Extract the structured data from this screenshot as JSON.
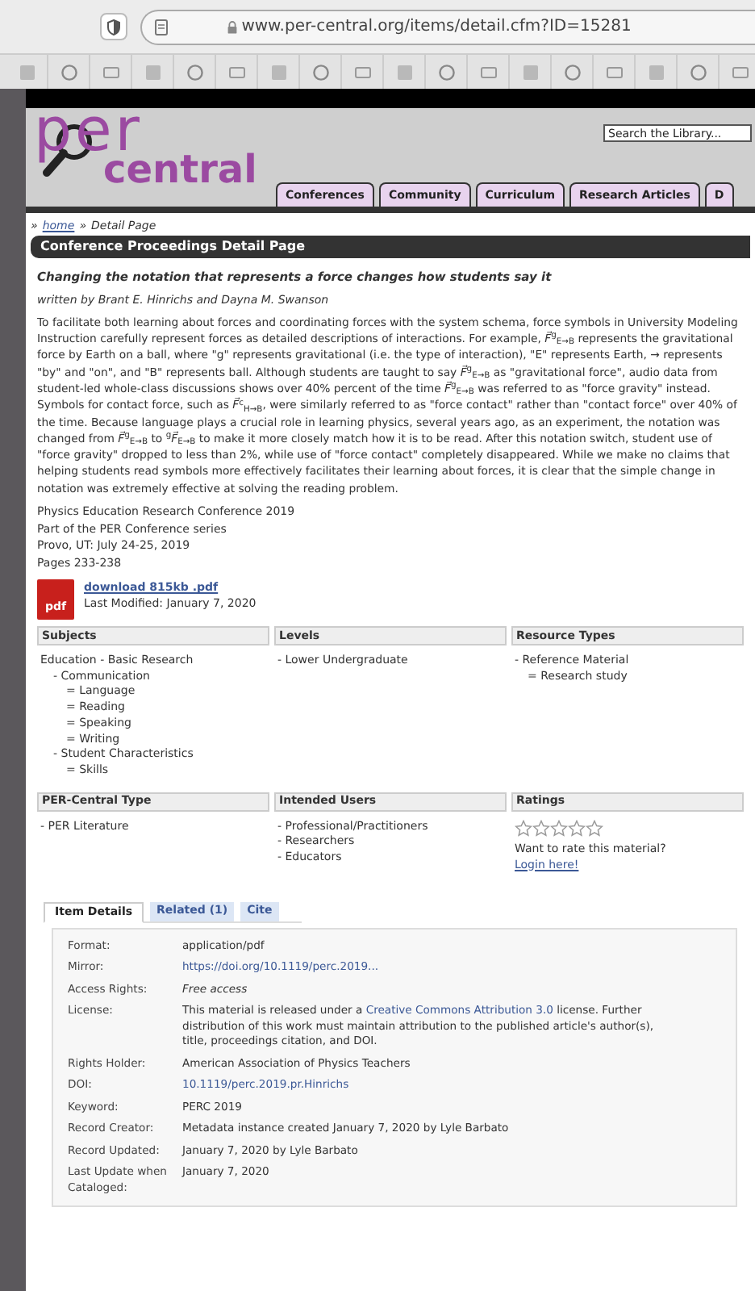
{
  "browser": {
    "url": "www.per-central.org/items/detail.cfm?ID=15281"
  },
  "header": {
    "logo_top": "per",
    "logo_bottom": "central",
    "search": {
      "placeholder": "Search the Library..."
    },
    "nav": [
      {
        "label": "Conferences"
      },
      {
        "label": "Community"
      },
      {
        "label": "Curriculum"
      },
      {
        "label": "Research Articles"
      },
      {
        "label": "D"
      }
    ]
  },
  "breadcrumb": [
    {
      "text": "»",
      "kind": "sep"
    },
    {
      "text": "home",
      "kind": "link"
    },
    {
      "text": "»",
      "kind": "sep"
    },
    {
      "text": "Detail Page",
      "kind": "text"
    }
  ],
  "section_title": "Conference Proceedings Detail Page",
  "item": {
    "title": "Changing the notation that represents a force changes how students say it",
    "byline": "written by Brant E. Hinrichs and Dayna M. Swanson",
    "abstract": "To facilitate both learning about forces and coordinating forces with the system schema, force symbols in University Modeling Instruction carefully represent forces as detailed descriptions of interactions. For example, *F⃗*$^{g}$$_{E→B}$ represents the gravitational force by Earth on a ball, where \"g\" represents gravitational (i.e. the type of interaction), \"E\" represents Earth, → represents \"by\" and \"on\", and \"B\" represents ball. Although students are taught to say *F⃗*$^{g}$$_{E→B}$ as \"gravitational force\", audio data from student-led whole-class discussions shows over 40% percent of the time *F⃗*$^{g}$$_{E→B}$ was referred to as \"force gravity\" instead. Symbols for contact force, such as *F⃗*$^{c}$$_{H→B}$, were similarly referred to as \"force contact\" rather than \"contact force\" over 40% of the time. Because language plays a crucial role in learning physics, several years ago, as an experiment, the notation was changed from *F⃗*$^{g}$$_{E→B}$ to $^{g}$*F⃗*$_{E→B}$ to make it more closely match how it is to be read. After this notation switch, student use of \"force gravity\" dropped to less than 2%, while use of \"force contact\" completely disappeared. While we make no claims that helping students read symbols more effectively facilitates their learning about forces, it is clear that the simple change in notation was extremely effective at solving the reading problem.",
    "info": [
      "Physics Education Research Conference 2019",
      "Part of the PER Conference series",
      "Provo, UT: July 24-25, 2019",
      "Pages 233-238"
    ],
    "file_badge": "pdf",
    "download": "download 815kb .pdf",
    "modified": "Last Modified: January 7, 2020"
  },
  "facets": [
    {
      "heading": "Subjects",
      "items": [
        {
          "text": "Education - Basic Research",
          "children": [
            {
              "text": "- Communication",
              "children": [
                {
                  "text": "= Language"
                },
                {
                  "text": "= Reading"
                },
                {
                  "text": "= Speaking"
                },
                {
                  "text": "= Writing"
                }
              ]
            },
            {
              "text": "- Student Characteristics",
              "children": [
                {
                  "text": "= Skills"
                }
              ]
            }
          ]
        }
      ]
    },
    {
      "heading": "Levels",
      "items": [
        {
          "text": "- Lower Undergraduate"
        }
      ]
    },
    {
      "heading": "Resource Types",
      "items": [
        {
          "text": "- Reference Material",
          "children": [
            {
              "text": "= Research study"
            }
          ]
        }
      ]
    },
    {
      "heading": "PER-Central Type",
      "items": [
        {
          "text": "- PER Literature"
        }
      ]
    },
    {
      "heading": "Intended Users",
      "items": [
        {
          "text": "- Professional/Practitioners"
        },
        {
          "text": "- Researchers"
        },
        {
          "text": "- Educators"
        }
      ]
    },
    {
      "heading": "Ratings",
      "kind": "ratings",
      "stars": 0,
      "prompt": "Want to rate this material?",
      "link": "Login here!"
    }
  ],
  "tabs": [
    {
      "label": "Item Details",
      "selected": true
    },
    {
      "label": "Related (1)",
      "selected": false
    },
    {
      "label": "Cite",
      "selected": false
    }
  ],
  "details": [
    {
      "label": "Format:",
      "kind": "text",
      "value": "application/pdf"
    },
    {
      "label": "Mirror:",
      "kind": "link",
      "value": "https://doi.org/10.1119/perc.2019..."
    },
    {
      "label": "Access Rights:",
      "kind": "italic",
      "value": "Free access"
    },
    {
      "label": "License:",
      "kind": "parts",
      "parts": [
        {
          "text": "This material is released under a ",
          "kind": "text"
        },
        {
          "text": "Creative Commons Attribution 3.0",
          "kind": "link"
        },
        {
          "text": " license. Further distribution of this work must maintain attribution to the published article's author(s), title, proceedings citation, and DOI.",
          "kind": "text"
        }
      ]
    },
    {
      "label": "Rights Holder:",
      "kind": "text",
      "value": "American Association of Physics Teachers"
    },
    {
      "label": "DOI:",
      "kind": "link",
      "value": "10.1119/perc.2019.pr.Hinrichs"
    },
    {
      "label": "Keyword:",
      "kind": "text",
      "value": "PERC 2019"
    },
    {
      "label": "Record Creator:",
      "kind": "text",
      "value": "Metadata instance created January 7, 2020 by Lyle Barbato"
    },
    {
      "label": "Record Updated:",
      "kind": "text",
      "value": "January 7, 2020 by Lyle Barbato"
    },
    {
      "label": "Last Update when Cataloged:",
      "kind": "text",
      "value": "January 7, 2020"
    }
  ]
}
